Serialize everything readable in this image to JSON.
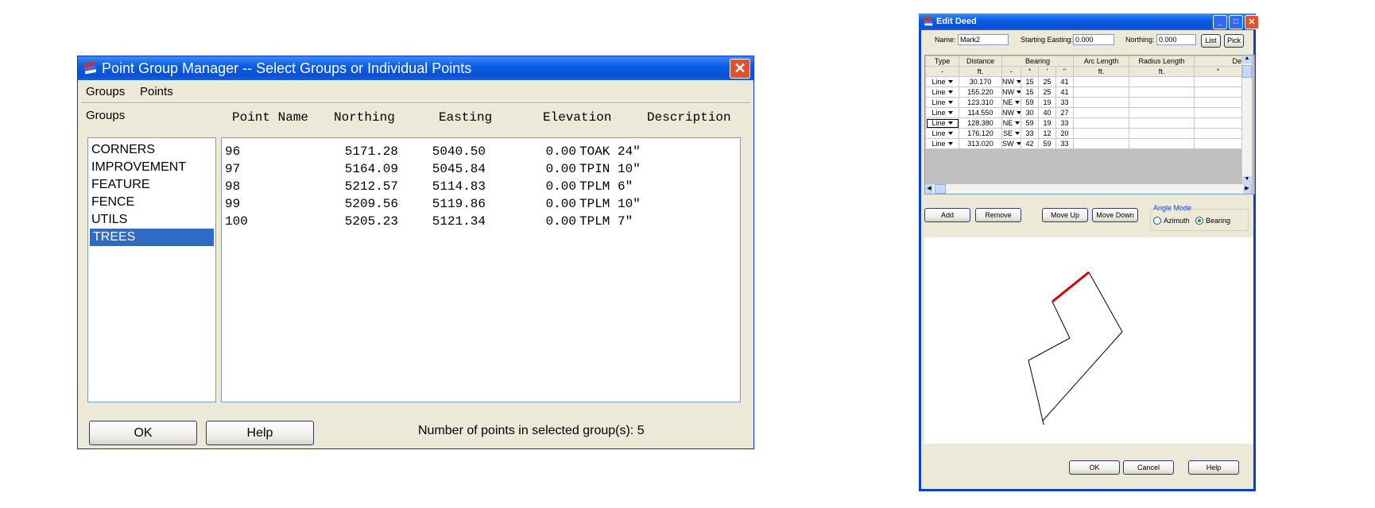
{
  "pgm": {
    "title": "Point Group Manager -- Select Groups or Individual Points",
    "menu": [
      "Groups",
      "Points"
    ],
    "groups_label": "Groups",
    "groups": [
      "CORNERS",
      "IMPROVEMENT",
      "FEATURE",
      "FENCE",
      "UTILS",
      "TREES"
    ],
    "selected_group": "TREES",
    "columns": [
      "Point Name",
      "Northing",
      "Easting",
      "Elevation",
      "Description"
    ],
    "points": [
      {
        "name": "96",
        "northing": "5171.28",
        "easting": "5040.50",
        "elevation": "0.00",
        "description": "TOAK 24\""
      },
      {
        "name": "97",
        "northing": "5164.09",
        "easting": "5045.84",
        "elevation": "0.00",
        "description": "TPIN 10\""
      },
      {
        "name": "98",
        "northing": "5212.57",
        "easting": "5114.83",
        "elevation": "0.00",
        "description": "TPLM 6\""
      },
      {
        "name": "99",
        "northing": "5209.56",
        "easting": "5119.86",
        "elevation": "0.00",
        "description": "TPLM 10\""
      },
      {
        "name": "100",
        "northing": "5205.23",
        "easting": "5121.34",
        "elevation": "0.00",
        "description": "TPLM 7\""
      }
    ],
    "ok_label": "OK",
    "help_label": "Help",
    "count_text": "Number of points in selected group(s):  5"
  },
  "deed": {
    "title": "Edit Deed",
    "name_label": "Name:",
    "name_value": "Mark2",
    "easting_label": "Starting Easting:",
    "easting_value": "0.000",
    "northing_label": "Northing:",
    "northing_value": "0.000",
    "list_label": "List",
    "pick_label": "Pick",
    "headers": [
      "Type",
      "Distance",
      "Bearing",
      "Arc Length",
      "Radius Length",
      "De"
    ],
    "units": [
      "-",
      "ft.",
      "-",
      "°",
      "'",
      "\"",
      "ft.",
      "ft.",
      "°"
    ],
    "rows": [
      {
        "type": "Line",
        "distance": "30.170",
        "quad": "NW",
        "deg": "15",
        "min": "25",
        "sec": "41"
      },
      {
        "type": "Line",
        "distance": "155.220",
        "quad": "NW",
        "deg": "15",
        "min": "25",
        "sec": "41"
      },
      {
        "type": "Line",
        "distance": "123.310",
        "quad": "NE",
        "deg": "59",
        "min": "19",
        "sec": "33"
      },
      {
        "type": "Line",
        "distance": "114.550",
        "quad": "NW",
        "deg": "30",
        "min": "40",
        "sec": "27"
      },
      {
        "type": "Line",
        "distance": "128.380",
        "quad": "NE",
        "deg": "59",
        "min": "19",
        "sec": "33"
      },
      {
        "type": "Line",
        "distance": "176.120",
        "quad": "SE",
        "deg": "33",
        "min": "12",
        "sec": "20"
      },
      {
        "type": "Line",
        "distance": "313.020",
        "quad": "SW",
        "deg": "42",
        "min": "59",
        "sec": "33"
      }
    ],
    "add_label": "Add",
    "remove_label": "Remove",
    "moveup_label": "Move Up",
    "movedown_label": "Move Down",
    "angle_mode_label": "Angle Mode",
    "azimuth_label": "Azimuth",
    "bearing_label": "Bearing",
    "angle_mode_selected": "Bearing",
    "ok_label": "OK",
    "cancel_label": "Cancel",
    "help_label": "Help",
    "highlight_color": "#d00000"
  }
}
